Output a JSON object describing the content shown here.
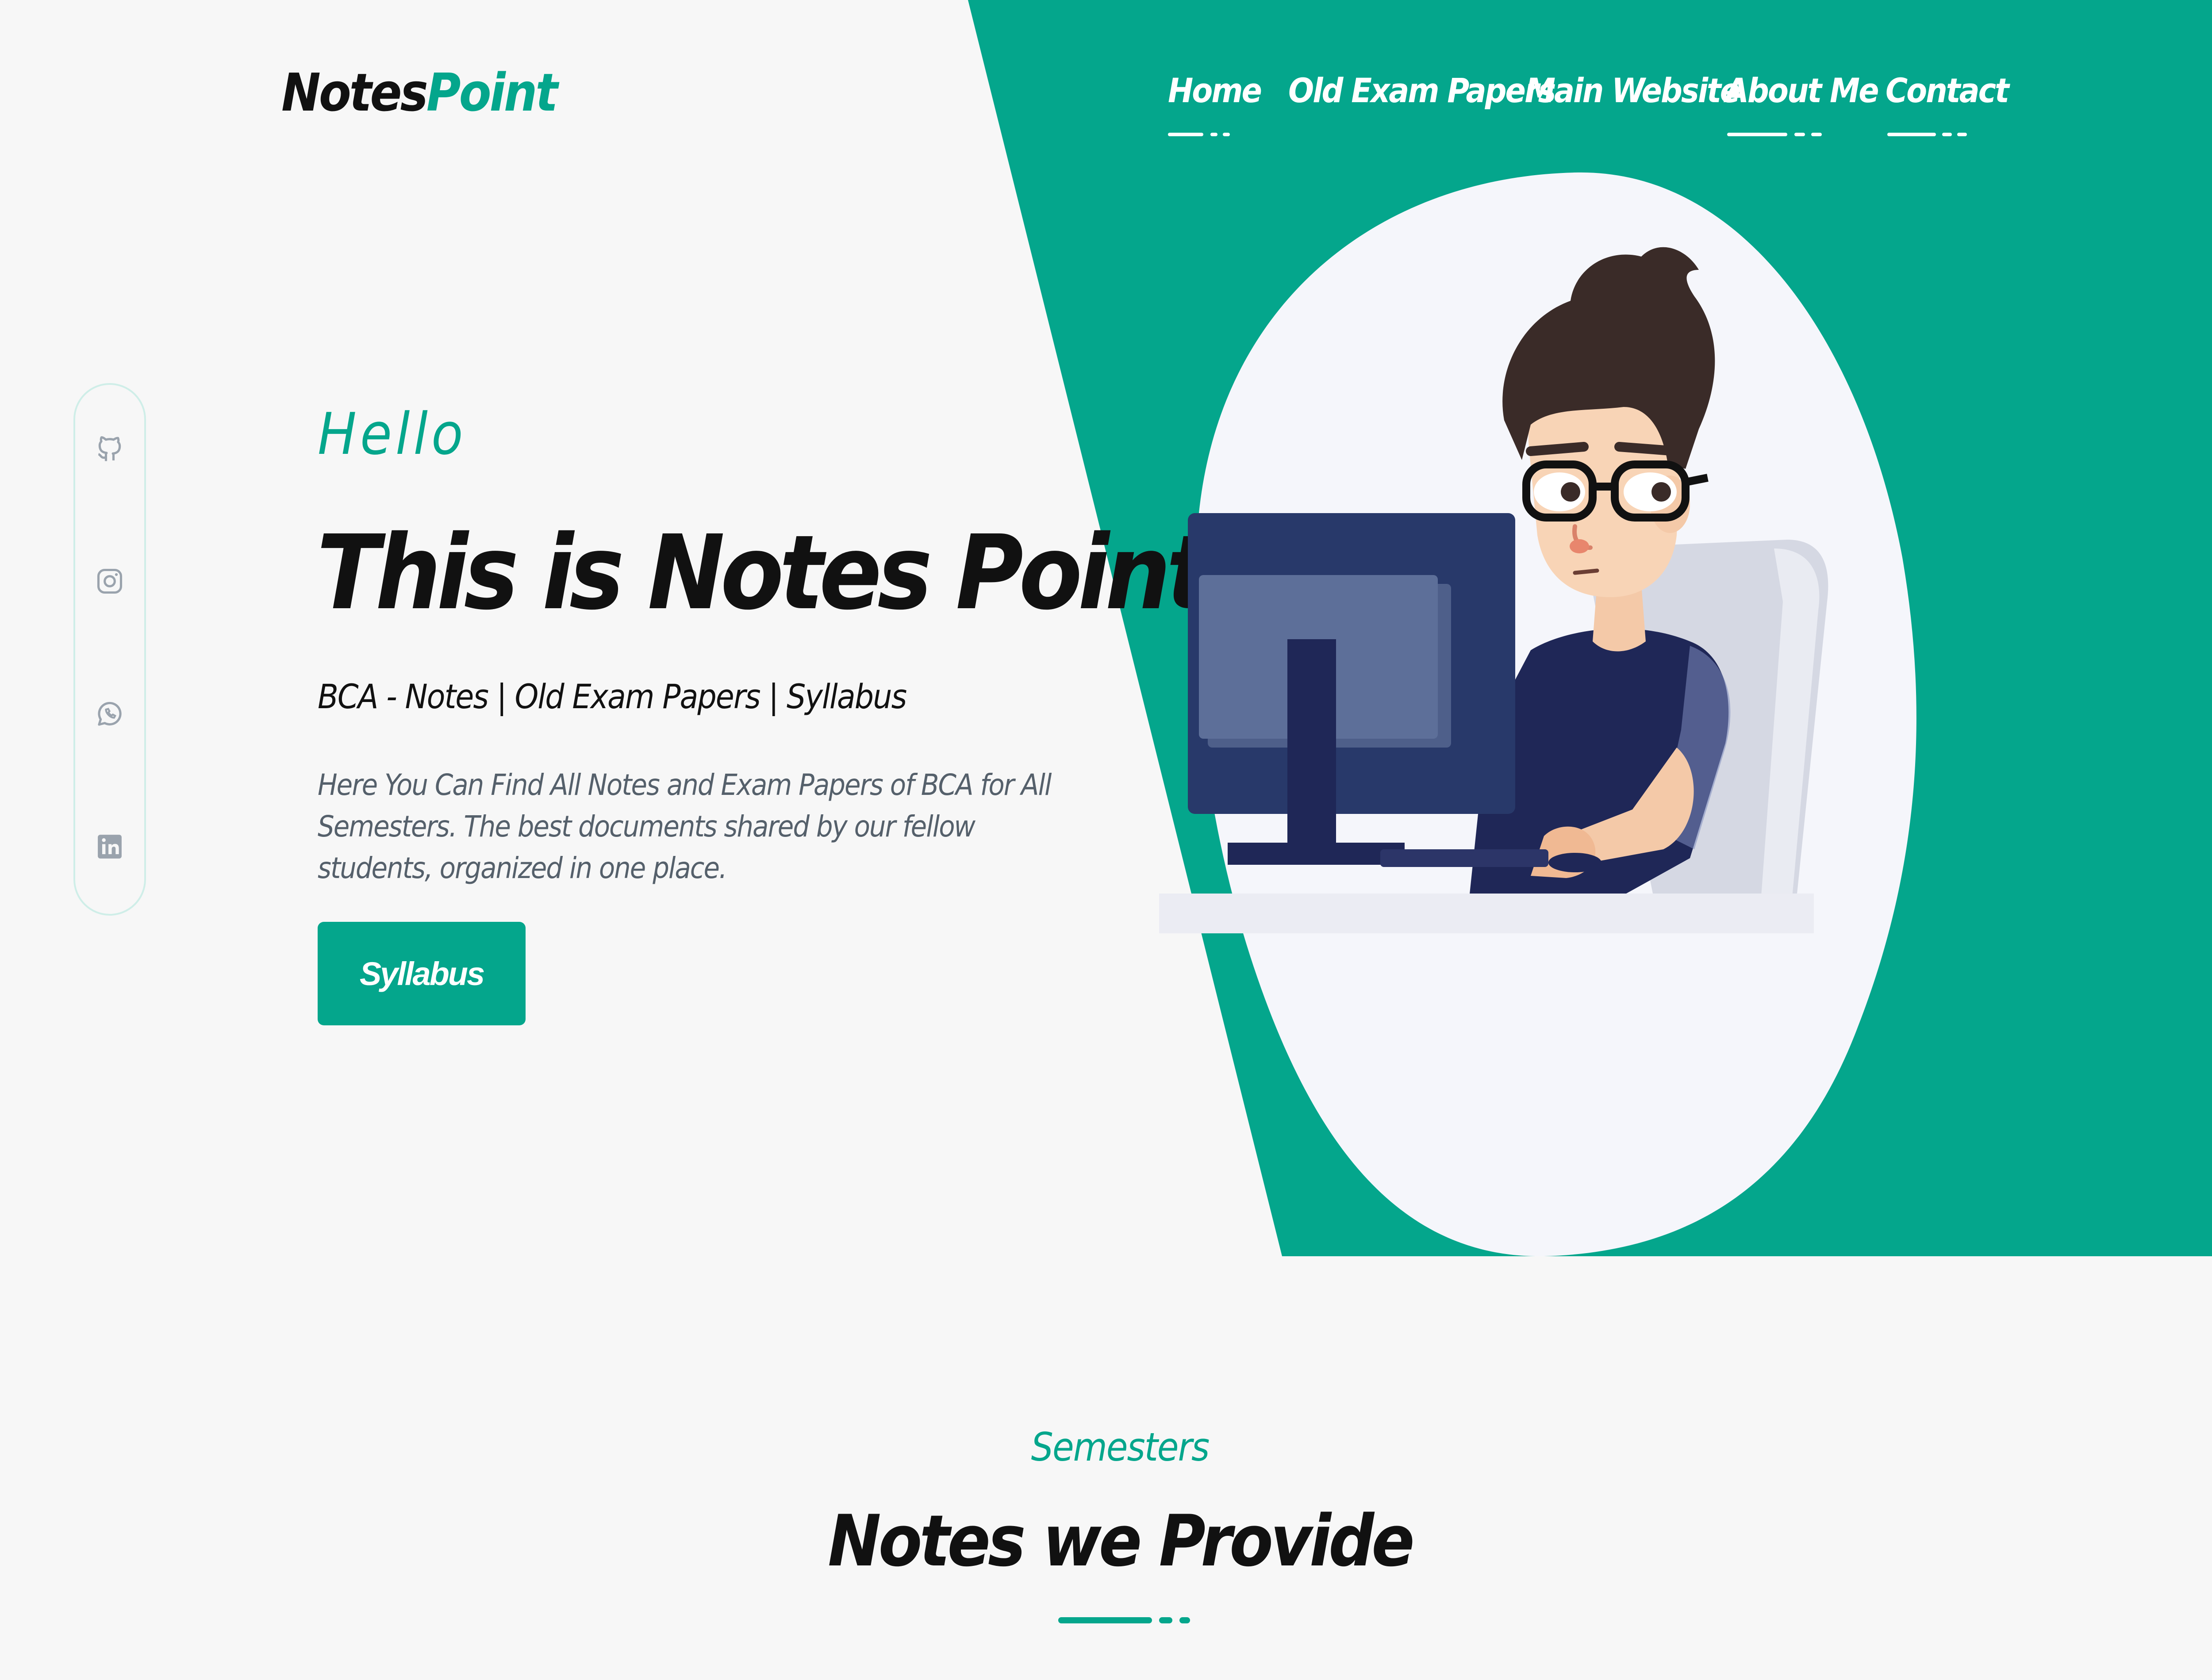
{
  "brand": {
    "logo_part1": "Notes",
    "logo_part2": "Point"
  },
  "colors": {
    "accent": "#04a68c",
    "background": "#f7f7f7",
    "nav_text": "#ffffff",
    "body_text": "#111111",
    "muted_text": "#55606b"
  },
  "nav": {
    "items": [
      {
        "label": "Home"
      },
      {
        "label": "Old Exam Papers"
      },
      {
        "label": "Main Website"
      },
      {
        "label": "About Me"
      },
      {
        "label": "Contact"
      }
    ]
  },
  "social": {
    "icons": [
      "github-icon",
      "instagram-icon",
      "whatsapp-icon",
      "linkedin-icon"
    ]
  },
  "hero": {
    "greeting": "Hello",
    "title": "This is Notes Point",
    "subtitle": "BCA - Notes | Old Exam Papers | Syllabus",
    "description": "Here You Can Find All Notes and Exam Papers of BCA for All Semesters. The best documents shared by our fellow students, organized in one place.",
    "cta_label": "Syllabus",
    "illustration": "student-at-computer-illustration"
  },
  "section": {
    "label": "Semesters",
    "title": "Notes we Provide"
  }
}
